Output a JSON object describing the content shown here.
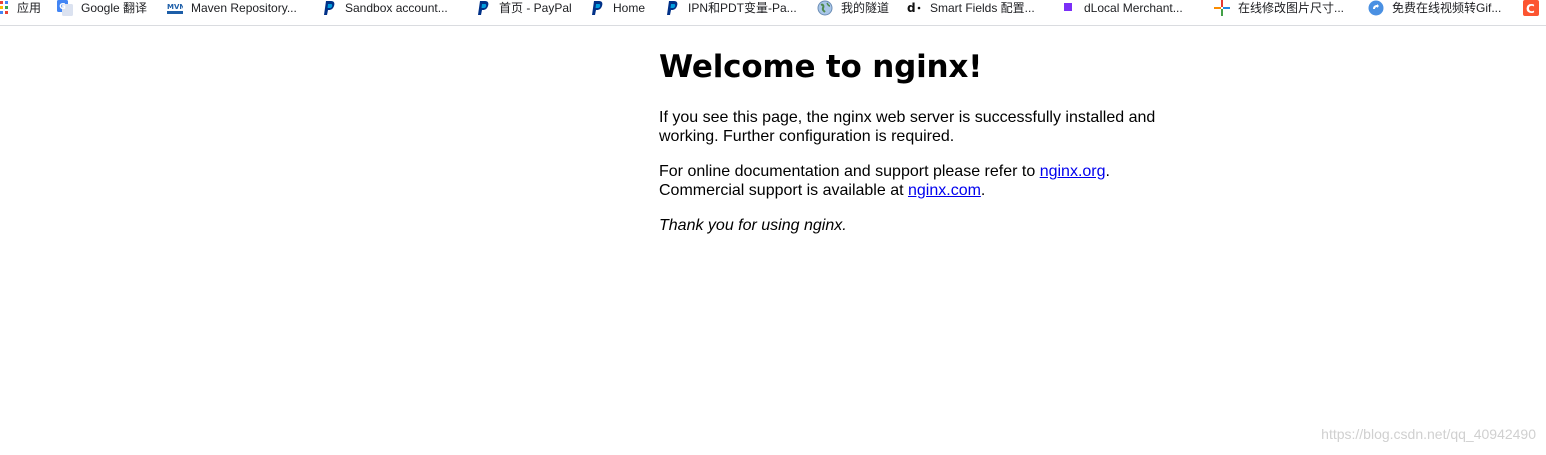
{
  "bookmarks": {
    "apps": "应用",
    "items": [
      {
        "label": "Google 翻译",
        "icon": "google-translate-icon"
      },
      {
        "label": "Maven Repository...",
        "icon": "maven-icon"
      },
      {
        "label": "Sandbox account...",
        "icon": "paypal-icon"
      },
      {
        "label": "首页 - PayPal",
        "icon": "paypal-icon"
      },
      {
        "label": "Home",
        "icon": "paypal-icon"
      },
      {
        "label": "IPN和PDT变量-Pa...",
        "icon": "paypal-icon"
      },
      {
        "label": "我的隧道",
        "icon": "globe-icon"
      },
      {
        "label": "Smart Fields 配置...",
        "icon": "dlocal-icon"
      },
      {
        "label": "dLocal Merchant...",
        "icon": "purple-square-icon"
      },
      {
        "label": "在线修改图片尺寸...",
        "icon": "pinwheel-icon"
      },
      {
        "label": "免费在线视频转Gif...",
        "icon": "gif-converter-icon"
      },
      {
        "label": "",
        "icon": "csdn-icon"
      }
    ]
  },
  "page": {
    "heading": "Welcome to nginx!",
    "p1": "If you see this page, the nginx web server is successfully installed and working. Further configuration is required.",
    "p2_prefix": "For online documentation and support please refer to ",
    "p2_link": "nginx.org",
    "p2_mid": ".",
    "p2_line2_prefix": "Commercial support is available at ",
    "p2_link2": "nginx.com",
    "p2_end": ".",
    "p3": "Thank you for using nginx."
  },
  "watermark": "https://blog.csdn.net/qq_40942490",
  "colors": {
    "link": "#0000ee",
    "paypal": "#003087",
    "maven": "#1d5ea8",
    "dlocal_purple": "#7b2ff7",
    "csdn": "#fc5531"
  }
}
